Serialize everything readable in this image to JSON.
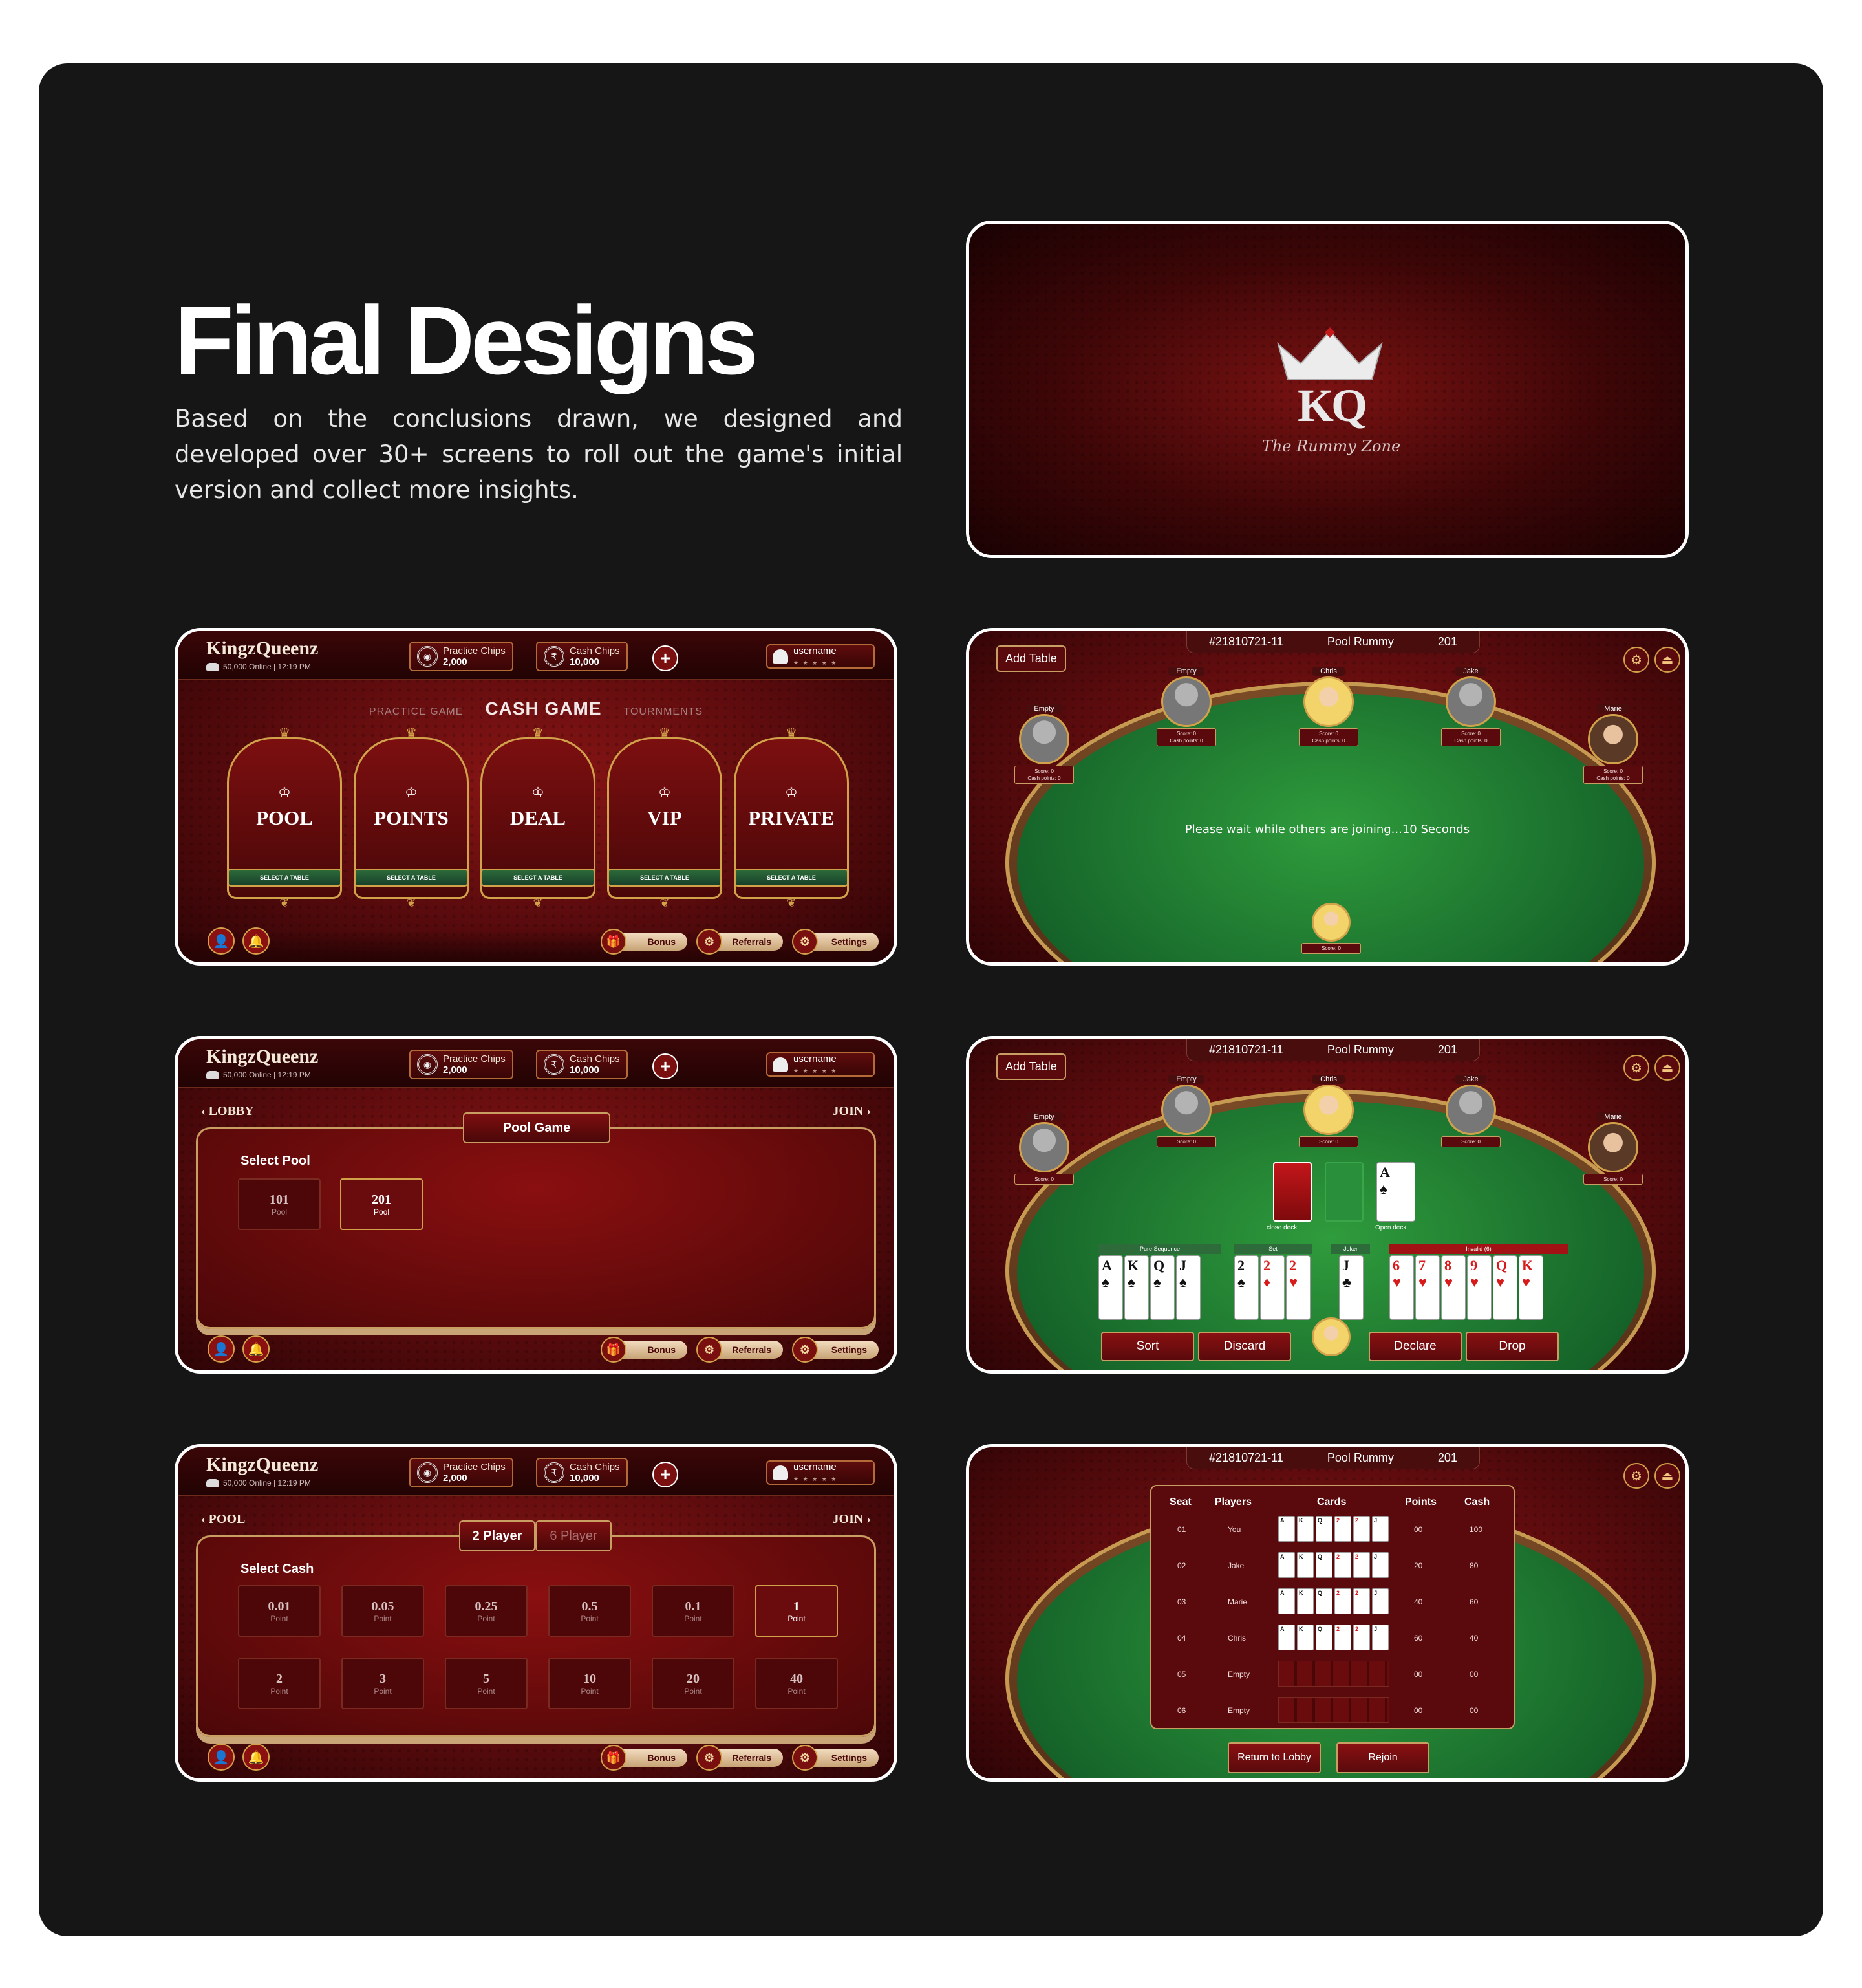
{
  "heading": {
    "title": "Final Designs",
    "description": "Based on the conclusions drawn, we designed and developed over 30+ screens to roll out the game's initial version and collect more insights."
  },
  "splash": {
    "logo": "KQ",
    "tagline": "The Rummy Zone"
  },
  "header": {
    "brand": "KingzQueenz",
    "online": "50,000 Online | 12:19 PM",
    "practice_label": "Practice Chips",
    "practice_value": "2,000",
    "cash_label": "Cash Chips",
    "cash_value": "10,000",
    "plus": "+",
    "username": "username",
    "stars": "★ ★ ★ ★ ★",
    "info": "i"
  },
  "lobby": {
    "tabs": [
      "PRACTICE GAME",
      "CASH GAME",
      "TOURNMENTS"
    ],
    "games": [
      "POOL",
      "POINTS",
      "DEAL",
      "VIP",
      "PRIVATE"
    ],
    "select_label": "SELECT A TABLE"
  },
  "footer": {
    "bonus": "Bonus",
    "referrals": "Referrals",
    "settings": "Settings"
  },
  "pool_screen": {
    "back": "LOBBY",
    "join": "JOIN",
    "tab": "Pool Game",
    "select_label": "Select Pool",
    "options": [
      {
        "value": "101",
        "unit": "Pool"
      },
      {
        "value": "201",
        "unit": "Pool"
      }
    ]
  },
  "cash_screen": {
    "back": "POOL",
    "join": "JOIN",
    "tabs": [
      "2 Player",
      "6 Player"
    ],
    "select_label": "Select Cash",
    "options": [
      {
        "value": "0.01",
        "unit": "Point"
      },
      {
        "value": "0.05",
        "unit": "Point"
      },
      {
        "value": "0.25",
        "unit": "Point"
      },
      {
        "value": "0.5",
        "unit": "Point"
      },
      {
        "value": "0.1",
        "unit": "Point"
      },
      {
        "value": "1",
        "unit": "Point"
      },
      {
        "value": "2",
        "unit": "Point"
      },
      {
        "value": "3",
        "unit": "Point"
      },
      {
        "value": "5",
        "unit": "Point"
      },
      {
        "value": "10",
        "unit": "Point"
      },
      {
        "value": "20",
        "unit": "Point"
      },
      {
        "value": "40",
        "unit": "Point"
      }
    ]
  },
  "table": {
    "id": "#21810721-11",
    "game": "Pool Rummy",
    "points": "201",
    "add_table": "Add Table",
    "wait_message": "Please wait while others are joining...10 Seconds",
    "seats": [
      "Empty",
      "Empty",
      "Chris",
      "Jake",
      "Marie"
    ],
    "score": "Score: 0",
    "cash_points": "Cash points: 0",
    "close_deck": "close deck",
    "open_deck": "Open deck",
    "groups": [
      "Pure Sequence",
      "Set",
      "Joker",
      "Invalid (6)"
    ],
    "buttons": [
      "Sort",
      "Discard",
      "Declare",
      "Drop"
    ]
  },
  "result": {
    "headers": [
      "Seat",
      "Players",
      "Cards",
      "Points",
      "Cash"
    ],
    "rows": [
      [
        "01",
        "You",
        "00",
        "100"
      ],
      [
        "02",
        "Jake",
        "20",
        "80"
      ],
      [
        "03",
        "Marie",
        "40",
        "60"
      ],
      [
        "04",
        "Chris",
        "60",
        "40"
      ],
      [
        "05",
        "Empty",
        "00",
        "00"
      ],
      [
        "06",
        "Empty",
        "00",
        "00"
      ]
    ],
    "return": "Return to Lobby",
    "rejoin": "Rejoin"
  }
}
